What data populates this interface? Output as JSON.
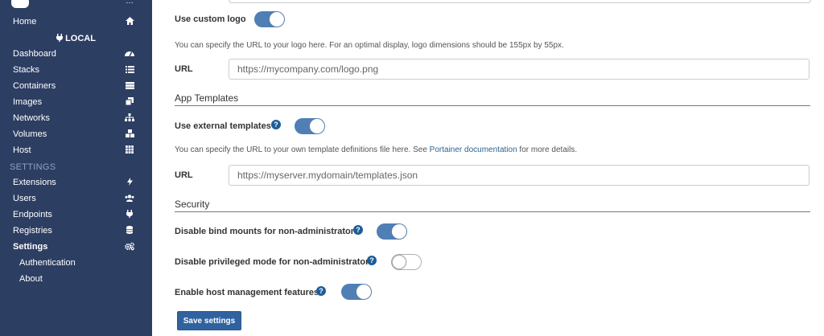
{
  "sidebar": {
    "items": [
      {
        "label": "Home",
        "icon": "home-icon"
      },
      {
        "label": "Dashboard",
        "icon": "tachometer-icon"
      },
      {
        "label": "Stacks",
        "icon": "list-icon"
      },
      {
        "label": "Containers",
        "icon": "server-icon"
      },
      {
        "label": "Images",
        "icon": "clone-icon"
      },
      {
        "label": "Networks",
        "icon": "sitemap-icon"
      },
      {
        "label": "Volumes",
        "icon": "cubes-icon"
      },
      {
        "label": "Host",
        "icon": "th-icon"
      },
      {
        "label": "Extensions",
        "icon": "bolt-icon"
      },
      {
        "label": "Users",
        "icon": "users-icon"
      },
      {
        "label": "Endpoints",
        "icon": "plug-icon"
      },
      {
        "label": "Registries",
        "icon": "database-icon"
      },
      {
        "label": "Settings",
        "icon": "cogs-icon"
      },
      {
        "label": "Authentication"
      },
      {
        "label": "About"
      }
    ],
    "local_label": "LOCAL",
    "settings_header": "SETTINGS"
  },
  "main": {
    "use_custom_logo": {
      "label": "Use custom logo",
      "on": true
    },
    "logo_help": "You can specify the URL to your logo here. For an optimal display, logo dimensions should be 155px by 55px.",
    "logo_url": {
      "label": "URL",
      "placeholder": "https://mycompany.com/logo.png"
    },
    "app_templates_title": "App Templates",
    "use_external_templates": {
      "label": "Use external templates",
      "on": true
    },
    "templates_help_pre": "You can specify the URL to your own template definitions file here. See",
    "templates_help_link": "Portainer documentation",
    "templates_help_post": "for more details.",
    "templates_url": {
      "label": "URL",
      "placeholder": "https://myserver.mydomain/templates.json"
    },
    "security_title": "Security",
    "disable_bind_mounts": {
      "label": "Disable bind mounts for non-administrators",
      "on": true
    },
    "disable_privileged": {
      "label": "Disable privileged mode for non-administrators",
      "on": false
    },
    "enable_host_mgmt": {
      "label": "Enable host management features",
      "on": true
    },
    "save_label": "Save settings"
  },
  "colors": {
    "sidebar_bg": "#2d3e63",
    "accent": "#4f7fb5",
    "button": "#30629f"
  }
}
